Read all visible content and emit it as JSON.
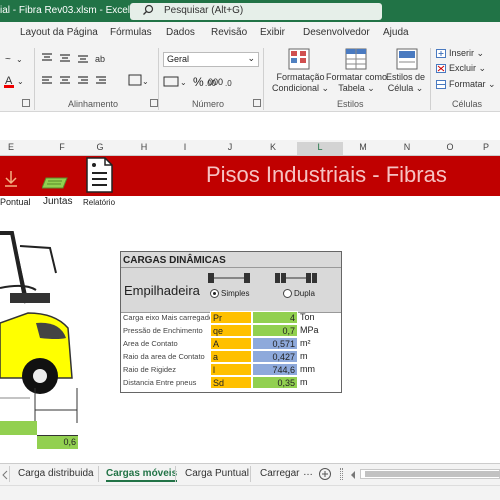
{
  "window": {
    "title": "ial - Fibra Rev03.xlsm  -  Excel",
    "search_placeholder": "Pesquisar (Alt+G)"
  },
  "menu": [
    "Layout da Página",
    "Fórmulas",
    "Dados",
    "Revisão",
    "Exibir",
    "Desenvolvedor",
    "Ajuda"
  ],
  "ribbon": {
    "number_format": "Geral",
    "groups": {
      "alignment": "Alinhamento",
      "number": "Número",
      "styles": "Estilos",
      "cells": "Células"
    },
    "styles_buttons": [
      "Formatação\nCondicional ⌄",
      "Formatar como\nTabela ⌄",
      "Estilos de\nCélula ⌄"
    ],
    "cells_buttons": [
      "Inserir ⌄",
      "Excluir ⌄",
      "Formatar ⌄"
    ],
    "percent": "%",
    "thousands": "000"
  },
  "columns": [
    "E",
    "F",
    "G",
    "H",
    "I",
    "J",
    "K",
    "L",
    "M",
    "N",
    "O",
    "P"
  ],
  "banner": {
    "title": "Pisos Industriais - Fibras"
  },
  "nav": {
    "pontual": "Pontual",
    "juntas": "Juntas",
    "relatorio": "Relatório"
  },
  "panel": {
    "title": "CARGAS DINÂMICAS",
    "subtitle": "Empilhadeira",
    "options": [
      "Simples",
      "Dupla"
    ],
    "selected": "Simples",
    "rows": [
      {
        "name": "Carga eixo Mais carregado",
        "symbol": "Pr",
        "value": "4",
        "unit": "Ton",
        "fill": "g"
      },
      {
        "name": "Pressão de Enchimento",
        "symbol": "qe",
        "value": "0,7",
        "unit": "MPa",
        "fill": "g"
      },
      {
        "name": "Area de Contato",
        "symbol": "A",
        "value": "0,571",
        "unit": "m²",
        "fill": "b"
      },
      {
        "name": "Raio da area de Contato",
        "symbol": "a",
        "value": "0,427",
        "unit": "m",
        "fill": "b"
      },
      {
        "name": "Raio de Rigidez",
        "symbol": "l",
        "value": "744,6",
        "unit": "mm",
        "fill": "b"
      },
      {
        "name": "Distancia Entre pneus",
        "symbol": "Sd",
        "value": "0,35",
        "unit": "m",
        "fill": "g"
      }
    ]
  },
  "diagram_value": "0,6",
  "tabs": [
    "Carga distribuida",
    "Cargas móveis",
    "Carga Puntual",
    "Carregar"
  ],
  "active_tab": "Cargas móveis",
  "colors": {
    "excel_green": "#217346",
    "banner_red": "#c00000",
    "input_green": "#92d050",
    "calc_blue": "#8ea9db",
    "symbol_orange": "#ffc000"
  }
}
